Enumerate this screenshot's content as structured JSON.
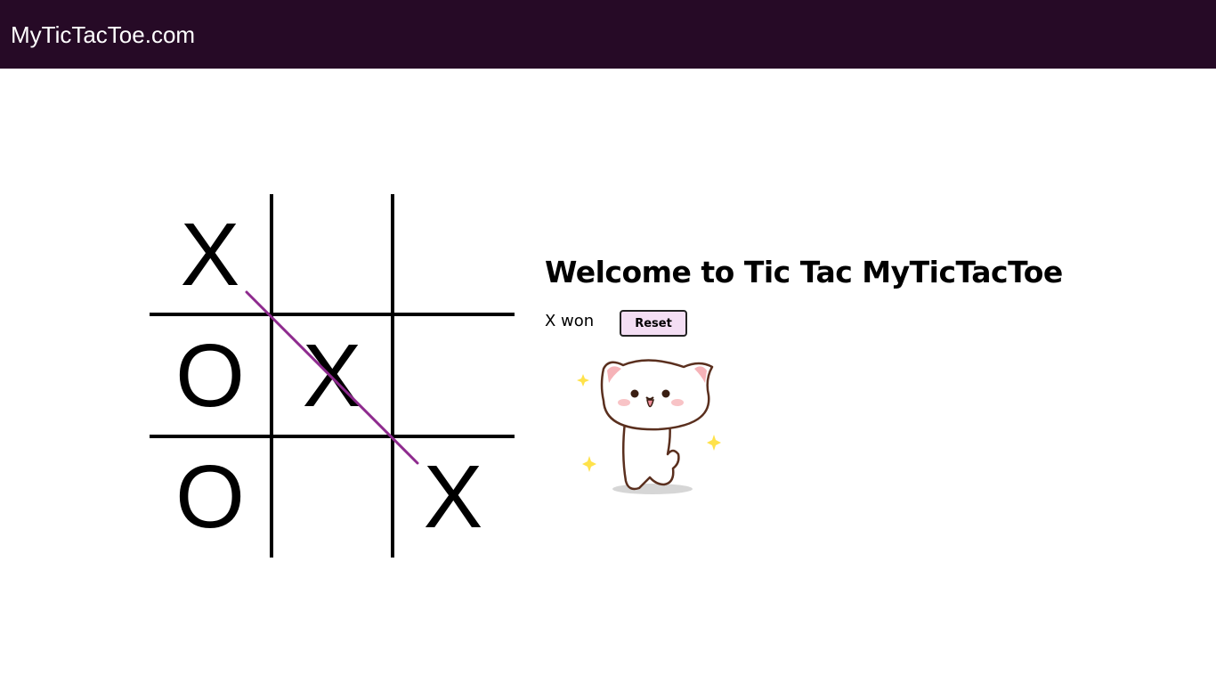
{
  "navbar": {
    "brand": "MyTicTacToe.com"
  },
  "game": {
    "title": "Welcome to Tic Tac MyTicTacToe",
    "status": "X won",
    "reset_label": "Reset",
    "board": [
      [
        "X",
        "",
        ""
      ],
      [
        "O",
        "X",
        ""
      ],
      [
        "O",
        "",
        "X"
      ]
    ],
    "winning_line": "diagonal top-left to bottom-right",
    "win_line_color": "#8e2a8e"
  },
  "colors": {
    "navbar_bg": "#260a26",
    "reset_bg": "#f3def3"
  },
  "sticker": {
    "icon": "dancing-cat-icon"
  }
}
